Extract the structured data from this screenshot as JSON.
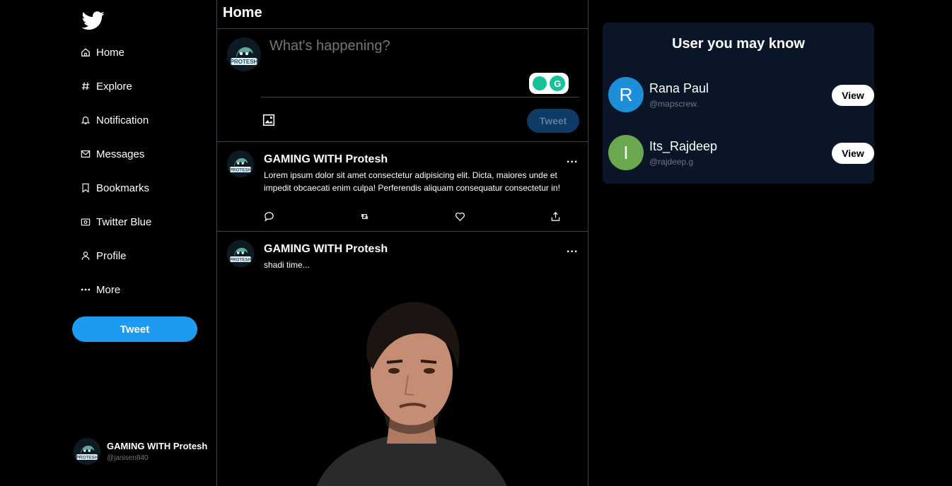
{
  "sidebar": {
    "items": [
      {
        "label": "Home",
        "icon": "home-icon"
      },
      {
        "label": "Explore",
        "icon": "hash-icon"
      },
      {
        "label": "Notification",
        "icon": "bell-icon"
      },
      {
        "label": "Messages",
        "icon": "mail-icon"
      },
      {
        "label": "Bookmarks",
        "icon": "bookmark-icon"
      },
      {
        "label": "Twitter Blue",
        "icon": "twitter-blue-icon"
      },
      {
        "label": "Profile",
        "icon": "user-icon"
      },
      {
        "label": "More",
        "icon": "more-icon"
      }
    ],
    "tweet_label": "Tweet",
    "profile": {
      "name": "GAMING WITH Protesh",
      "handle": "@janisen840"
    }
  },
  "main": {
    "title": "Home",
    "composer": {
      "placeholder": "What's happening?",
      "tweet_label": "Tweet"
    },
    "posts": [
      {
        "author": "GAMING WITH Protesh",
        "more": "...",
        "text": "Lorem ipsum dolor sit amet consectetur adipisicing elit. Dicta, maiores unde et impedit obcaecati enim culpa! Perferendis aliquam consequatur consectetur in!"
      },
      {
        "author": "GAMING WITH Protesh",
        "more": "...",
        "text": "shadi time..."
      }
    ]
  },
  "suggestions": {
    "title": "User you may know",
    "users": [
      {
        "initial": "R",
        "name": "Rana Paul",
        "handle": "@mapscrew.",
        "view": "View",
        "color": "#1d8fd8"
      },
      {
        "initial": "I",
        "name": "Its_Rajdeep",
        "handle": "@rajdeep.g",
        "view": "View",
        "color": "#6aa84f"
      }
    ]
  },
  "colors": {
    "accent": "#1d9bf0",
    "background": "#000000",
    "card": "#0a1628"
  }
}
